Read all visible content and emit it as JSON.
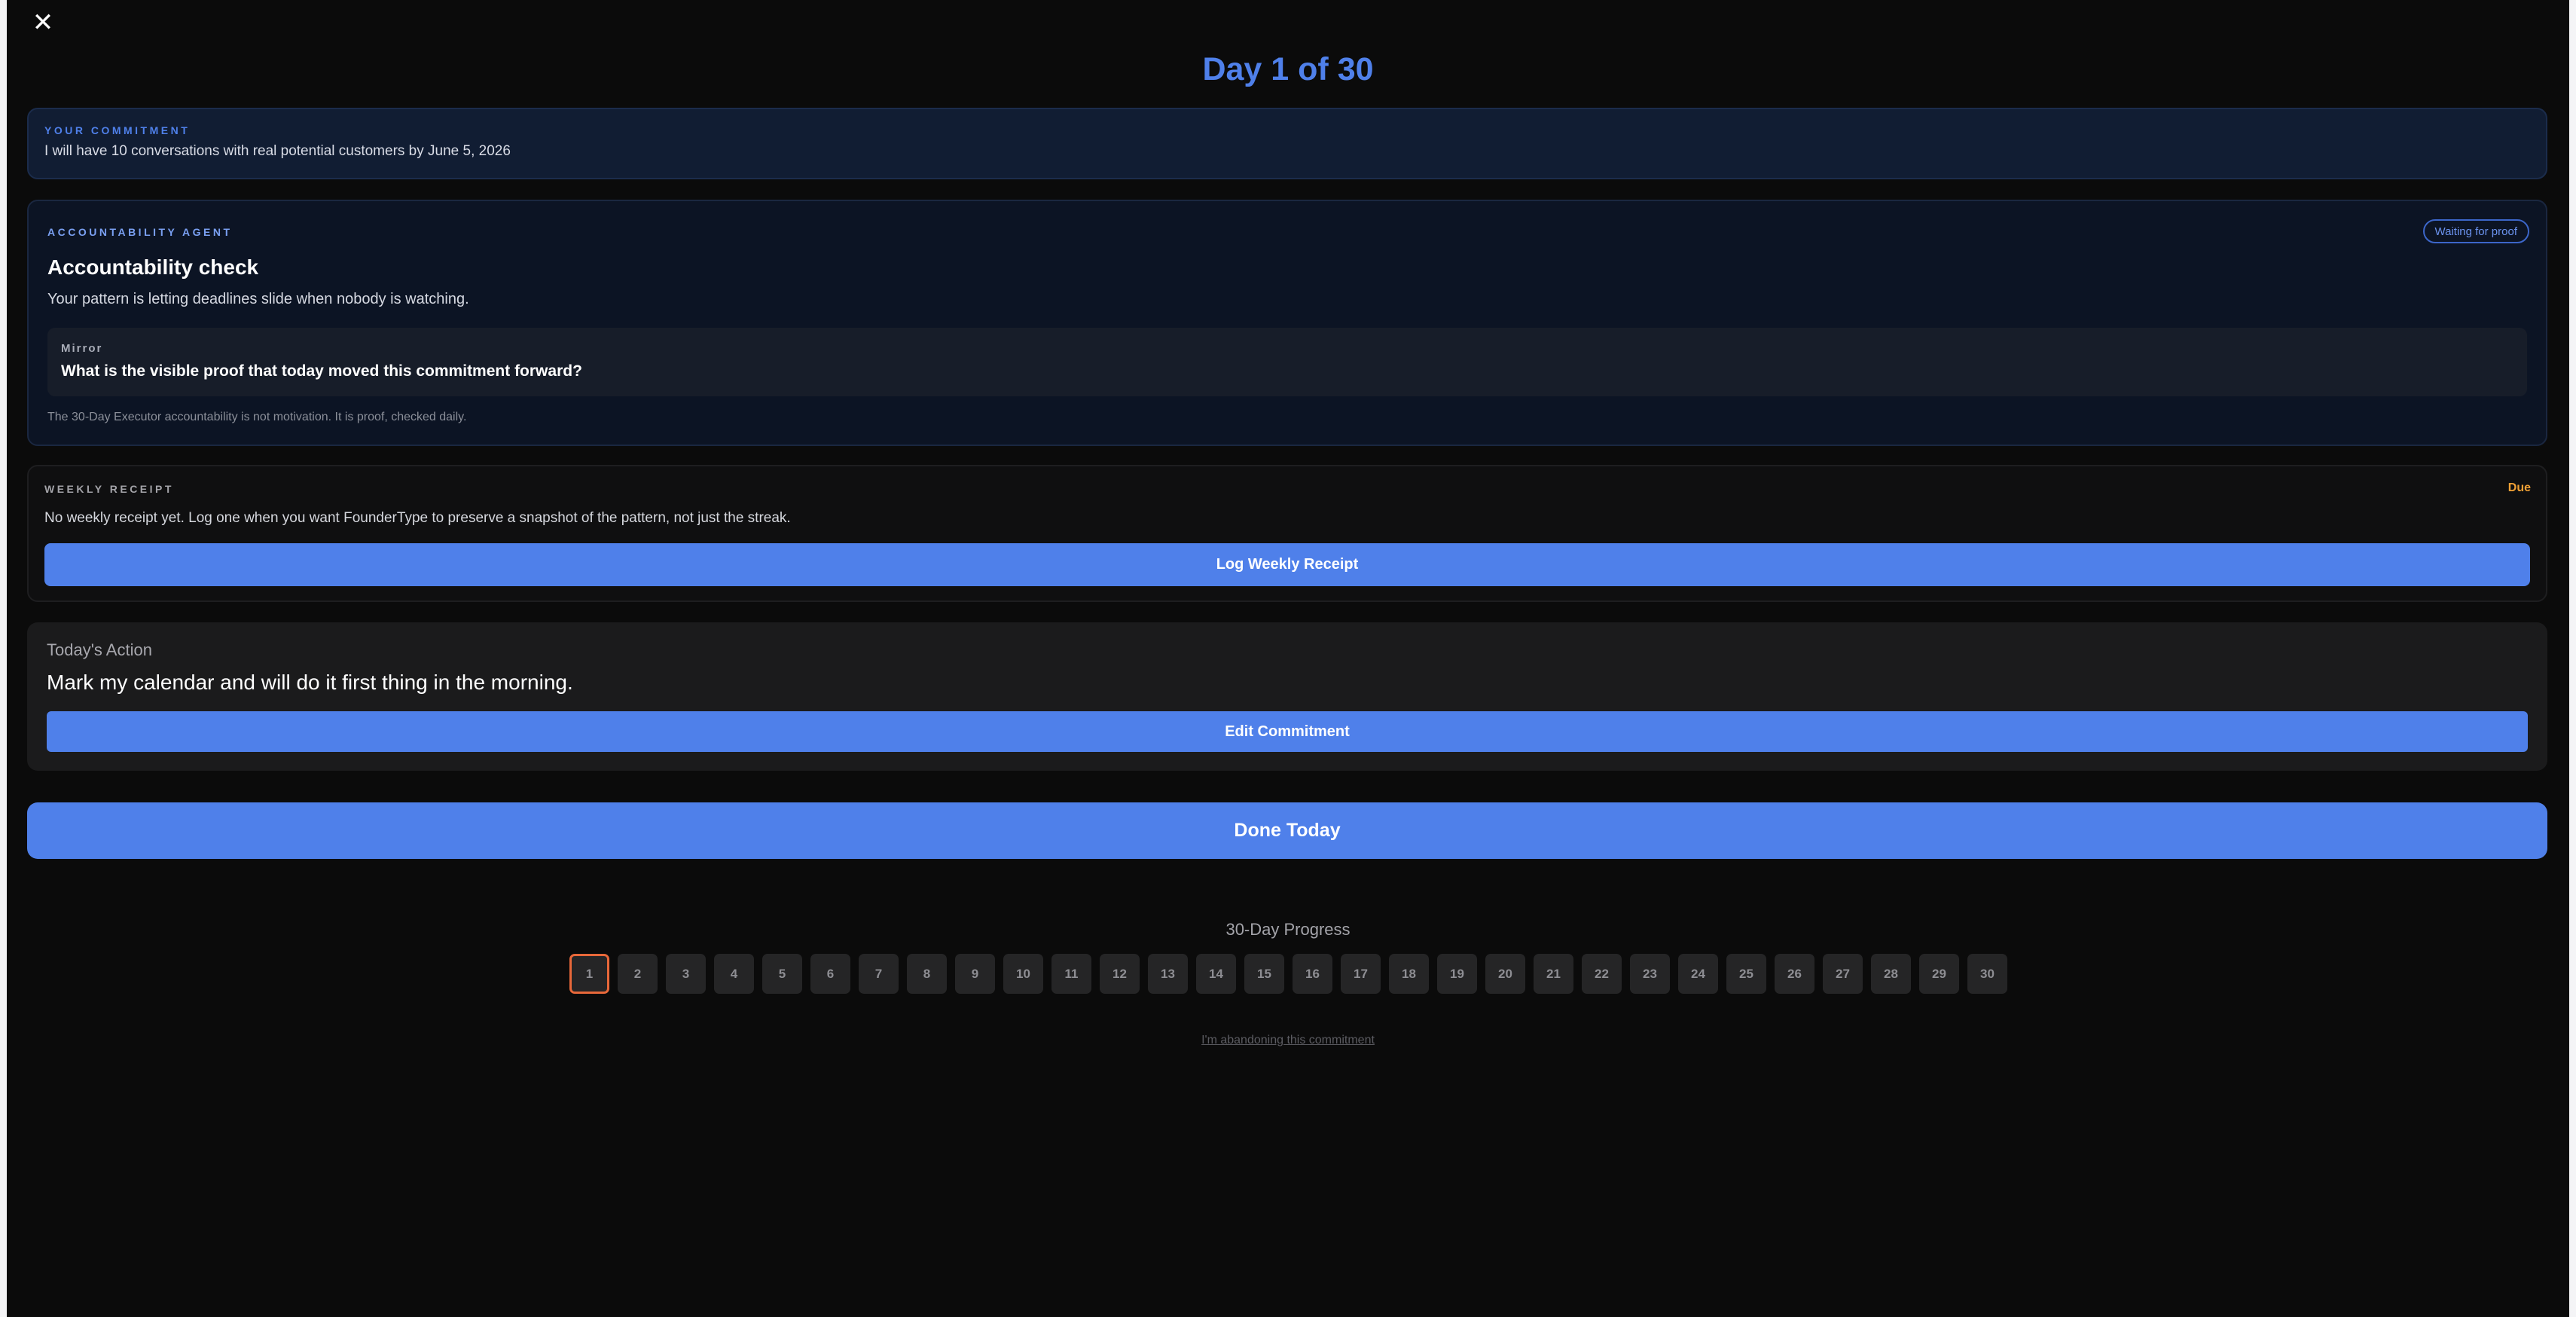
{
  "header": {
    "close_glyph": "✕",
    "day_title": "Day 1 of 30"
  },
  "commitment": {
    "eyebrow": "YOUR COMMITMENT",
    "text": "I will have 10 conversations with real potential customers by June 5, 2026"
  },
  "agent": {
    "eyebrow": "ACCOUNTABILITY AGENT",
    "status_badge": "Waiting for proof",
    "heading": "Accountability check",
    "pattern": "Your pattern is letting deadlines slide when nobody is watching.",
    "mirror_label": "Mirror",
    "mirror_question": "What is the visible proof that today moved this commitment forward?",
    "footnote": "The 30-Day Executor accountability is not motivation. It is proof, checked daily."
  },
  "weekly_receipt": {
    "eyebrow": "WEEKLY RECEIPT",
    "status": "Due",
    "text": "No weekly receipt yet. Log one when you want FounderType to preserve a snapshot of the pattern, not just the streak.",
    "button_label": "Log Weekly Receipt"
  },
  "todays_action": {
    "label": "Today's Action",
    "text": "Mark my calendar and will do it first thing in the morning.",
    "button_label": "Edit Commitment"
  },
  "done_button_label": "Done Today",
  "progress": {
    "title": "30-Day Progress",
    "current_day": 1,
    "days": [
      "1",
      "2",
      "3",
      "4",
      "5",
      "6",
      "7",
      "8",
      "9",
      "10",
      "11",
      "12",
      "13",
      "14",
      "15",
      "16",
      "17",
      "18",
      "19",
      "20",
      "21",
      "22",
      "23",
      "24",
      "25",
      "26",
      "27",
      "28",
      "29",
      "30"
    ]
  },
  "abandon_link": "I'm abandoning this commitment",
  "colors": {
    "accent": "#4f80ea",
    "due": "#f0a035",
    "current_day_border": "#e8683a",
    "background": "#0b0b0b"
  }
}
